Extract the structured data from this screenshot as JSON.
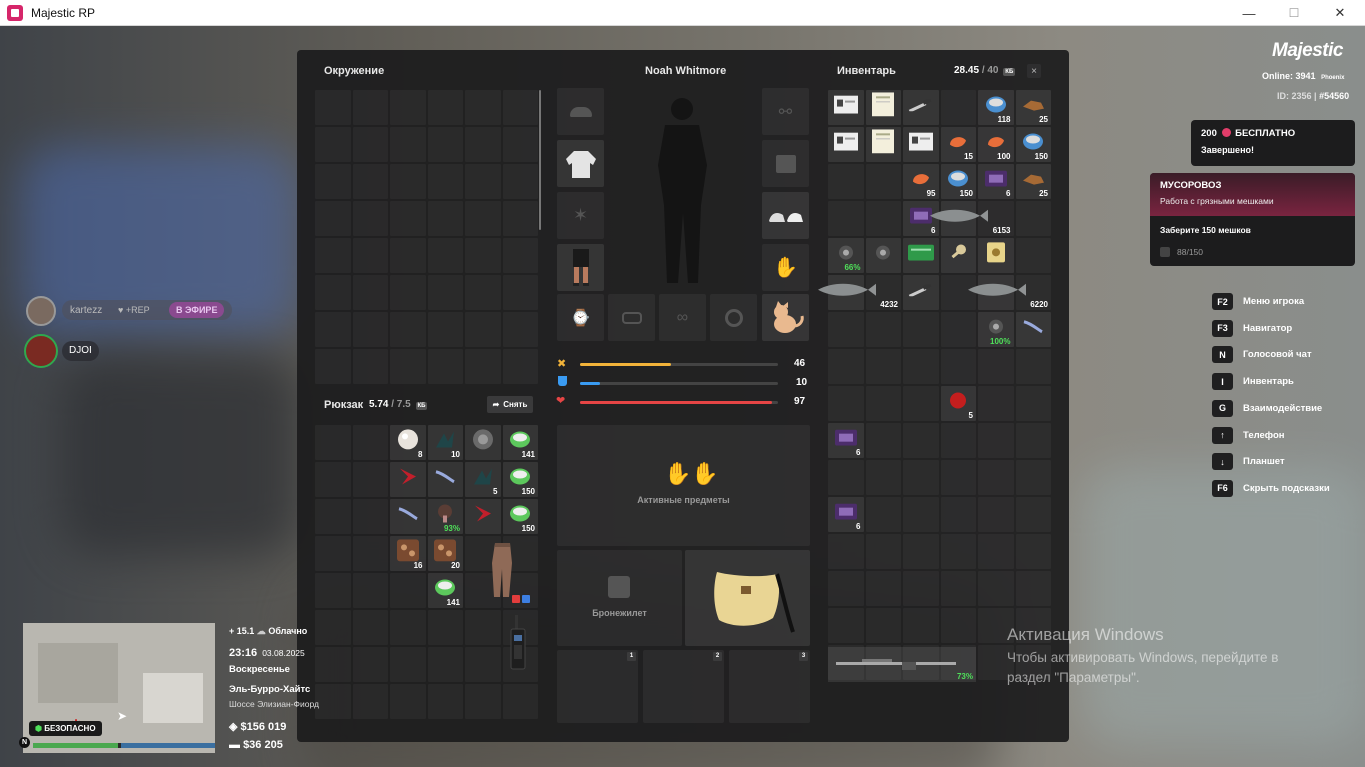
{
  "window": {
    "title": "Majestic RP",
    "minimize": "—",
    "maximize": "☐",
    "close": "✕"
  },
  "env_panel": {
    "title": "Окружение"
  },
  "character": {
    "name": "Noah Whitmore"
  },
  "inventory": {
    "title": "Инвентарь",
    "weight": "28.45",
    "weight_max": "/ 40",
    "unit": "КБ",
    "close": "×",
    "counts": {
      "r0c4": "118",
      "r0c5": "25",
      "r1c3": "15",
      "r1c4": "100",
      "r1c5": "150",
      "r2c2": "95",
      "r2c3": "150",
      "r2c4": "6",
      "r2c5": "25",
      "r3c2": "6",
      "r3c4": "6153",
      "r4c0": "66%",
      "r5c1": "4232",
      "r5c5": "6220",
      "r6c4": "100%",
      "r8c3": "5",
      "r9c0": "6",
      "r11c0": "6",
      "rifle": "73%"
    }
  },
  "backpack": {
    "title": "Рюкзак",
    "weight": "5.74",
    "weight_max": "/ 7.5",
    "unit": "КБ",
    "remove_label": "Снять",
    "counts": {
      "r0c2": "8",
      "r0c3": "10",
      "r0c5": "141",
      "r1c4": "5",
      "r1c5": "150",
      "r2c3": "93%",
      "r2c5": "150",
      "r3c2": "16",
      "r3c3": "20",
      "r4c3": "141"
    }
  },
  "stats": {
    "hunger": 46,
    "thirst": 10,
    "health": 97,
    "hunger_color": "#f2b33a",
    "thirst_color": "#3a9bf2",
    "health_color": "#e64545"
  },
  "active_items": {
    "label": "Активные предметы"
  },
  "armor": {
    "label": "Бронежилет"
  },
  "quick_slots": [
    "1",
    "2",
    "3"
  ],
  "brand": {
    "logo": "Majestic",
    "online_label": "Online:",
    "online": "3941",
    "server": "Phoenix",
    "id_label": "ID: 2356 |",
    "id_hash": "#54560"
  },
  "notification": {
    "line1": "200",
    "line1b": "БЕСПЛАТНО",
    "line2": "Завершено!"
  },
  "job": {
    "title": "МУСОРОВОЗ",
    "subtitle": "Работа с грязными мешками",
    "task": "Заберите 150 мешков",
    "progress": "88/150"
  },
  "hints": [
    {
      "key": "F2",
      "label": "Меню игрока"
    },
    {
      "key": "F3",
      "label": "Навигатор"
    },
    {
      "key": "N",
      "label": "Голосовой чат"
    },
    {
      "key": "I",
      "label": "Инвентарь"
    },
    {
      "key": "G",
      "label": "Взаимодействие"
    },
    {
      "key": "↑",
      "label": "Телефон"
    },
    {
      "key": "↓",
      "label": "Планшет"
    },
    {
      "key": "F6",
      "label": "Скрыть подсказки"
    }
  ],
  "voice": [
    {
      "name": "kartezz",
      "badge": "+REP",
      "live": "В ЭФИРЕ"
    },
    {
      "name": "DJOI"
    }
  ],
  "hud": {
    "weather": "+ 15.1",
    "weather_text": "Облачно",
    "time": "23:16",
    "date": "03.08.2025",
    "weekday": "Воскресенье",
    "district": "Эль-Бурро-Хайтс",
    "street": "Шоссе Элизиан-Фиорд",
    "safe": "БЕЗОПАСНО",
    "cash": "$156 019",
    "bank": "$36 205",
    "compass": "N"
  },
  "watermark": {
    "line1": "Активация Windows",
    "line2": "Чтобы активировать Windows, перейдите в",
    "line3": "раздел \"Параметры\"."
  }
}
